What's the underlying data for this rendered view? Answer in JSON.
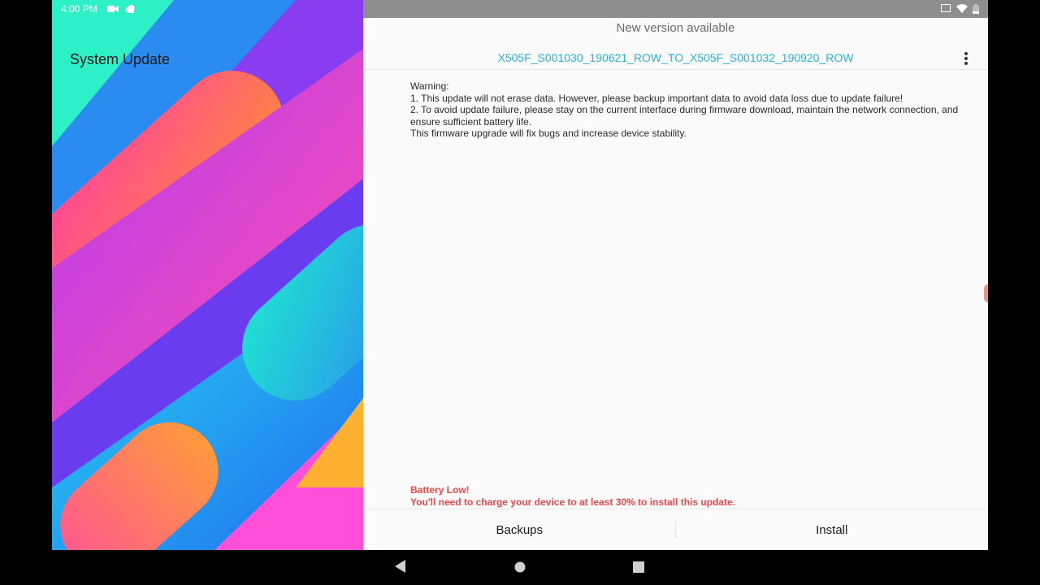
{
  "status_bar": {
    "time": "4:00 PM",
    "icons_left": [
      "video-camera-icon",
      "cloud-icon"
    ],
    "icons_right": [
      "cast-icon",
      "wifi-icon",
      "battery-icon"
    ]
  },
  "app": {
    "title": "System Update"
  },
  "update": {
    "header": "New version available",
    "version": "X505F_S001030_190621_ROW_TO_X505F_S001032_190920_ROW",
    "warning_lines": [
      "Warning:",
      "1. This update will not erase data. However, please backup important data to avoid data loss due to update failure!",
      "2. To avoid update failure, please stay on the current interface during firmware download, maintain the network connection, and ensure sufficient battery life.",
      "This firmware upgrade will fix bugs and increase device stability."
    ],
    "battery_title": "Battery Low!",
    "battery_message": "You'll need to charge your device to at least 30% to install this update."
  },
  "actions": {
    "backups_label": "Backups",
    "install_label": "Install"
  },
  "nav": {
    "icons": [
      "back-icon",
      "home-icon",
      "recents-icon"
    ]
  },
  "colors": {
    "accent": "#2ab0d8",
    "warning": "#e84a4a",
    "background": "#fafafa"
  }
}
